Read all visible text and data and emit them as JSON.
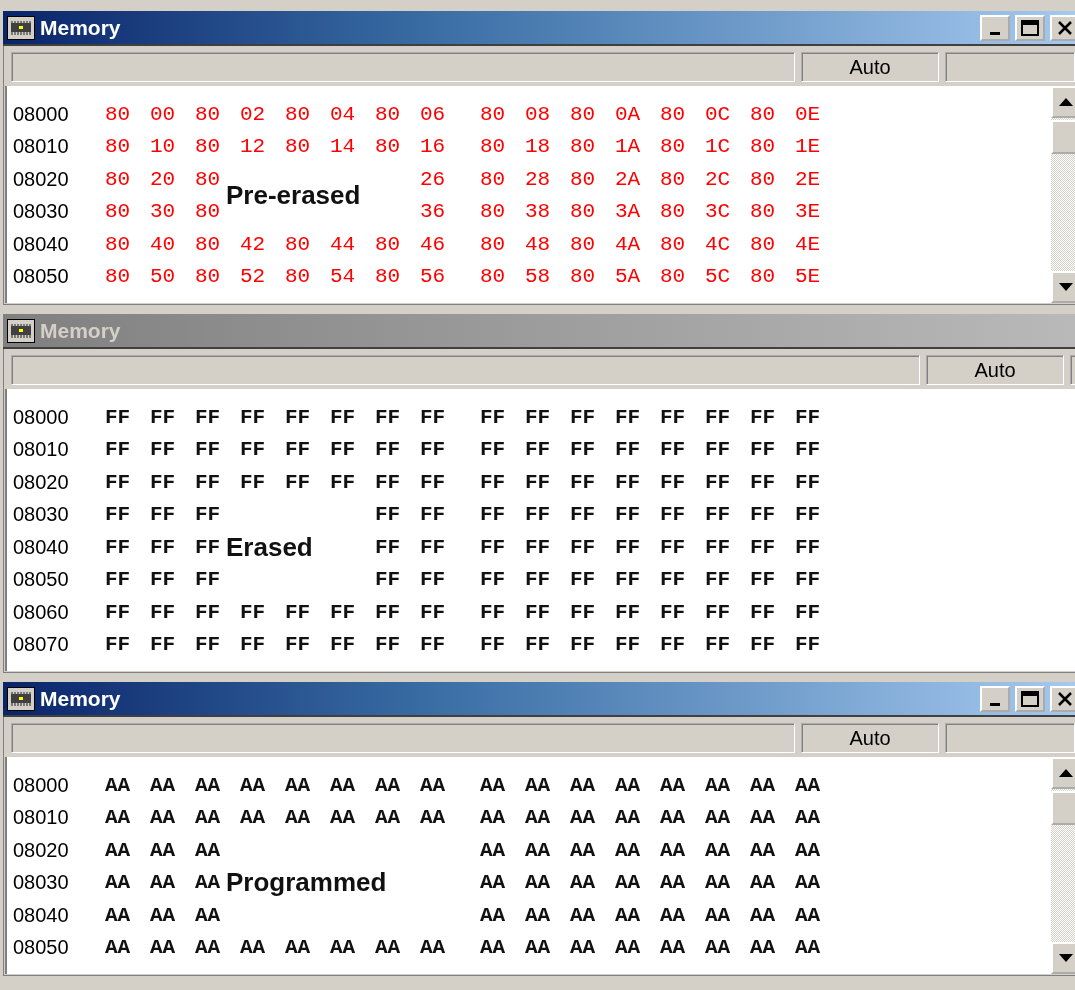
{
  "windows": [
    {
      "title": "Memory",
      "active": true,
      "highlighted": true,
      "scrollbar": true,
      "buttons": [
        {
          "kind": "minimize"
        },
        {
          "kind": "maximize"
        },
        {
          "kind": "close"
        }
      ],
      "mode": "Auto",
      "overlay": "Pre-erased",
      "rows": [
        {
          "address": "08000",
          "bytes": [
            "80",
            "00",
            "80",
            "02",
            "80",
            "04",
            "80",
            "06",
            "80",
            "08",
            "80",
            "0A",
            "80",
            "0C",
            "80",
            "0E"
          ]
        },
        {
          "address": "08010",
          "bytes": [
            "80",
            "10",
            "80",
            "12",
            "80",
            "14",
            "80",
            "16",
            "80",
            "18",
            "80",
            "1A",
            "80",
            "1C",
            "80",
            "1E"
          ]
        },
        {
          "address": "08020",
          "bytes": [
            "80",
            "20",
            "80"
          ],
          "bytes_after": [
            "26",
            "80",
            "28",
            "80",
            "2A",
            "80",
            "2C",
            "80",
            "2E"
          ]
        },
        {
          "address": "08030",
          "bytes": [
            "80",
            "30",
            "80"
          ],
          "bytes_after": [
            "36",
            "80",
            "38",
            "80",
            "3A",
            "80",
            "3C",
            "80",
            "3E"
          ]
        },
        {
          "address": "08040",
          "bytes": [
            "80",
            "40",
            "80",
            "42",
            "80",
            "44",
            "80",
            "46",
            "80",
            "48",
            "80",
            "4A",
            "80",
            "4C",
            "80",
            "4E"
          ]
        },
        {
          "address": "08050",
          "bytes": [
            "80",
            "50",
            "80",
            "52",
            "80",
            "54",
            "80",
            "56",
            "80",
            "58",
            "80",
            "5A",
            "80",
            "5C",
            "80",
            "5E"
          ]
        }
      ]
    },
    {
      "title": "Memory",
      "active": false,
      "highlighted": false,
      "mode": "Auto",
      "overlay": "Erased",
      "rows": [
        {
          "address": "08000",
          "bytes": [
            "FF",
            "FF",
            "FF",
            "FF",
            "FF",
            "FF",
            "FF",
            "FF",
            "FF",
            "FF",
            "FF",
            "FF",
            "FF",
            "FF",
            "FF",
            "FF"
          ]
        },
        {
          "address": "08010",
          "bytes": [
            "FF",
            "FF",
            "FF",
            "FF",
            "FF",
            "FF",
            "FF",
            "FF",
            "FF",
            "FF",
            "FF",
            "FF",
            "FF",
            "FF",
            "FF",
            "FF"
          ]
        },
        {
          "address": "08020",
          "bytes": [
            "FF",
            "FF",
            "FF",
            "FF",
            "FF",
            "FF",
            "FF",
            "FF",
            "FF",
            "FF",
            "FF",
            "FF",
            "FF",
            "FF",
            "FF",
            "FF"
          ]
        },
        {
          "address": "08030",
          "bytes": [
            "FF",
            "FF",
            "FF"
          ],
          "bytes_after": [
            "FF",
            "FF",
            "FF",
            "FF",
            "FF",
            "FF",
            "FF",
            "FF",
            "FF",
            "FF"
          ]
        },
        {
          "address": "08040",
          "bytes": [
            "FF",
            "FF",
            "FF"
          ],
          "bytes_after": [
            "FF",
            "FF",
            "FF",
            "FF",
            "FF",
            "FF",
            "FF",
            "FF",
            "FF",
            "FF"
          ]
        },
        {
          "address": "08050",
          "bytes": [
            "FF",
            "FF",
            "FF"
          ],
          "bytes_after": [
            "FF",
            "FF",
            "FF",
            "FF",
            "FF",
            "FF",
            "FF",
            "FF",
            "FF",
            "FF"
          ]
        },
        {
          "address": "08060",
          "bytes": [
            "FF",
            "FF",
            "FF",
            "FF",
            "FF",
            "FF",
            "FF",
            "FF",
            "FF",
            "FF",
            "FF",
            "FF",
            "FF",
            "FF",
            "FF",
            "FF"
          ]
        },
        {
          "address": "08070",
          "bytes": [
            "FF",
            "FF",
            "FF",
            "FF",
            "FF",
            "FF",
            "FF",
            "FF",
            "FF",
            "FF",
            "FF",
            "FF",
            "FF",
            "FF",
            "FF",
            "FF"
          ]
        }
      ]
    },
    {
      "title": "Memory",
      "active": true,
      "highlighted": false,
      "scrollbar": true,
      "buttons": [
        {
          "kind": "minimize"
        },
        {
          "kind": "maximize"
        },
        {
          "kind": "close"
        }
      ],
      "mode": "Auto",
      "overlay": "Programmed",
      "rows": [
        {
          "address": "08000",
          "bytes": [
            "AA",
            "AA",
            "AA",
            "AA",
            "AA",
            "AA",
            "AA",
            "AA",
            "AA",
            "AA",
            "AA",
            "AA",
            "AA",
            "AA",
            "AA",
            "AA"
          ]
        },
        {
          "address": "08010",
          "bytes": [
            "AA",
            "AA",
            "AA",
            "AA",
            "AA",
            "AA",
            "AA",
            "AA",
            "AA",
            "AA",
            "AA",
            "AA",
            "AA",
            "AA",
            "AA",
            "AA"
          ]
        },
        {
          "address": "08020",
          "bytes": [
            "AA",
            "AA",
            "AA"
          ],
          "bytes_after": [
            "AA",
            "AA",
            "AA",
            "AA",
            "AA",
            "AA",
            "AA",
            "AA"
          ]
        },
        {
          "address": "08030",
          "bytes": [
            "AA",
            "AA",
            "AA"
          ],
          "bytes_after": [
            "AA",
            "AA",
            "AA",
            "AA",
            "AA",
            "AA",
            "AA",
            "AA"
          ]
        },
        {
          "address": "08040",
          "bytes": [
            "AA",
            "AA",
            "AA"
          ],
          "bytes_after": [
            "AA",
            "AA",
            "AA",
            "AA",
            "AA",
            "AA",
            "AA",
            "AA"
          ]
        },
        {
          "address": "08050",
          "bytes": [
            "AA",
            "AA",
            "AA",
            "AA",
            "AA",
            "AA",
            "AA",
            "AA",
            "AA",
            "AA",
            "AA",
            "AA",
            "AA",
            "AA",
            "AA",
            "AA"
          ]
        }
      ]
    }
  ]
}
